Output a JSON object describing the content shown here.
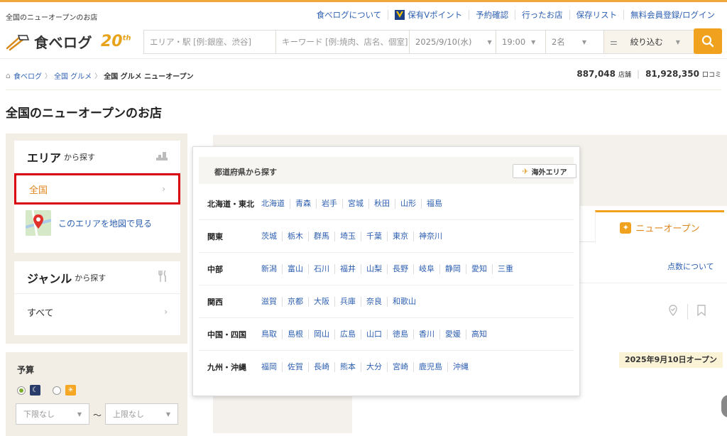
{
  "util": {
    "left_text": "全国のニューオープンのお店",
    "links": [
      "食べログについて",
      "保有Vポイント",
      "予約確認",
      "行ったお店",
      "保存リスト",
      "無料会員登録/ログイン"
    ]
  },
  "header": {
    "logo_text": "食べログ",
    "logo_badge": "20",
    "logo_badge_suffix": "th",
    "area_placeholder": "エリア・駅 [例:銀座、渋谷]",
    "keyword_placeholder": "キーワード [例:焼肉、店名、個室]",
    "date": "2025/9/10(水)",
    "time": "19:00",
    "people": "2名",
    "filter_label": "絞り込む"
  },
  "breadcrumb": [
    "食べログ",
    "全国 グルメ",
    "全国 グルメ ニューオープン"
  ],
  "stats": {
    "stores": "887,048",
    "stores_unit": "店舗",
    "reviews": "81,928,350",
    "reviews_unit": "口コミ"
  },
  "page_title": "全国のニューオープンのお店",
  "sidebar": {
    "area_title": "エリア",
    "area_suffix": "から探す",
    "area_selected": "全国",
    "map_link": "このエリアを地図で見る",
    "genre_title": "ジャンル",
    "genre_suffix": "から探す",
    "genre_selected": "すべて",
    "budget_title": "予算",
    "budget_min": "下限なし",
    "budget_max": "上限なし",
    "budget_tilde": "〜"
  },
  "panel": {
    "title": "都道府県から探す",
    "overseas": "海外エリア",
    "regions": [
      {
        "name": "北海道・東北",
        "prefs": [
          "北海道",
          "青森",
          "岩手",
          "宮城",
          "秋田",
          "山形",
          "福島"
        ]
      },
      {
        "name": "関東",
        "prefs": [
          "茨城",
          "栃木",
          "群馬",
          "埼玉",
          "千葉",
          "東京",
          "神奈川"
        ]
      },
      {
        "name": "中部",
        "prefs": [
          "新潟",
          "富山",
          "石川",
          "福井",
          "山梨",
          "長野",
          "岐阜",
          "静岡",
          "愛知",
          "三重"
        ]
      },
      {
        "name": "関西",
        "prefs": [
          "滋賀",
          "京都",
          "大阪",
          "兵庫",
          "奈良",
          "和歌山"
        ]
      },
      {
        "name": "中国・四国",
        "prefs": [
          "鳥取",
          "島根",
          "岡山",
          "広島",
          "山口",
          "徳島",
          "香川",
          "愛媛",
          "高知"
        ]
      },
      {
        "name": "九州・沖縄",
        "prefs": [
          "福岡",
          "佐賀",
          "長崎",
          "熊本",
          "大分",
          "宮崎",
          "鹿児島",
          "沖縄"
        ]
      }
    ]
  },
  "main": {
    "tab_newopen": "ニューオープン",
    "score_link": "点数について",
    "open_date": "2025年9月10日オープン"
  },
  "colors": {
    "accent": "#f0a21e",
    "link": "#2d5fb1",
    "highlight_border": "#d9000f"
  }
}
